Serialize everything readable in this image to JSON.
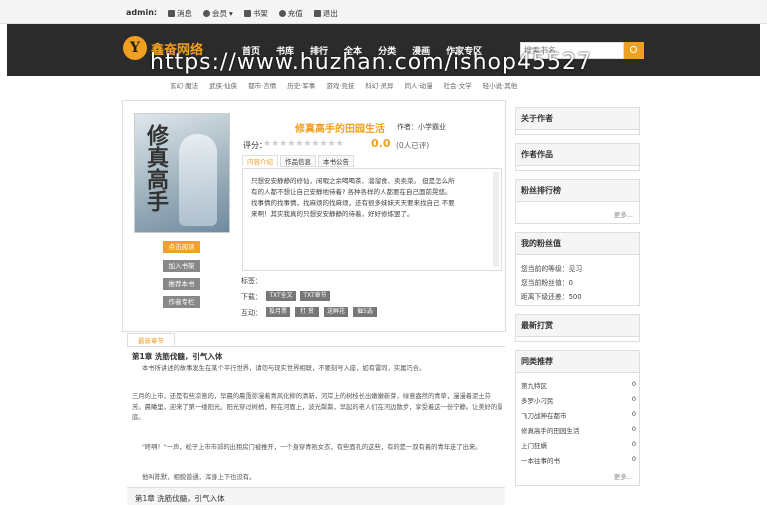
{
  "topbar": {
    "user": "admin:",
    "links": [
      {
        "icon": "message-icon",
        "label": "消息"
      },
      {
        "icon": "user-icon",
        "label": "会员"
      },
      {
        "icon": "book-icon",
        "label": "书架"
      },
      {
        "icon": "recharge-icon",
        "label": "充值"
      },
      {
        "icon": "logout-icon",
        "label": "退出"
      }
    ]
  },
  "header": {
    "logo_mark": "Y",
    "logo_text": "鑫奋网络",
    "nav": [
      "首页",
      "书库",
      "排行",
      "全本",
      "分类",
      "漫画",
      "作家专区"
    ],
    "search_placeholder": "搜索书名",
    "accent": "#f0a020"
  },
  "watermark": "https://www.huzhan.com/ishop45527",
  "categories": [
    "玄幻·魔法",
    "武侠·仙侠",
    "都市·言情",
    "历史·军事",
    "游戏·竞技",
    "科幻·灵异",
    "同人·动漫",
    "社会·文学",
    "轻小说·其他"
  ],
  "book": {
    "title": "修真高手的田园生活",
    "author_label": "作者：",
    "author": "小学霸业",
    "cover_title": "修真高手",
    "rating_label": "评分：",
    "stars": "★★★★★★★★★★",
    "score": "0.0",
    "score_count": "(0人已评)",
    "tabs": [
      "内容介绍",
      "作品信息",
      "本书公告"
    ],
    "intro": [
      "只想安安静静的修仙，闲暇之余喝喝茶、溜溜食、卖卖菜。 但是怎么所",
      "有的人都不想让自己安静地待着?  各种各样的人都要在自己面前晃悠。",
      "找事情的找事情，找麻烦的找麻烦，还有很多妹妹天天要来找自己   不要",
      "来啊！其实我真的只想安安静静的待着，好好修炼罢了。"
    ],
    "buttons": [
      "点击阅读",
      "加入书架",
      "推荐本书",
      "作者专栏"
    ],
    "tags_label": "标签：",
    "download_label": "下载：",
    "downloads": [
      "TXT全文",
      "TXT章节"
    ],
    "interact_label": "互动：",
    "interacts": [
      "投月票",
      "打 赏",
      "送鲜花",
      "催5选"
    ]
  },
  "latest": {
    "tab": "最新章节",
    "chapter_title": "第1章 洗筋伐髓，引气入体",
    "paras": [
      "本书所讲述的故事发生在某个平行世界，请勿与现实世界相联，不要刻号入座，如有雷同，实属巧合。",
      "三月的上市，还是有些凉意的，早晨的晨霭弥漫着青风化柳的清新，河岸上的树枝长出嫩嫩新芽，绿意盎然的青草，漫漫着泥土芬",
      "芳。晨曦里，迎来了第一缕阳光。阳光穿过树梢，照在河面上，波光粼粼，早起的老人们在河边散步，享受着这一份宁静。让美好的景色尽收眼",
      "底。",
      "\"咚啊！\"一声，松子上市市郊的出租房门被推开，一个身穿青袍女衣，有些面孔的这些，有的是一双有着的青年走了出来。",
      "他叫陈默，相貌普通，浑身上下也没有。"
    ],
    "bottom": "第1章 洗筋伐髓，引气入体"
  },
  "sidebar": {
    "about_author": "关于作者",
    "author_works": "作者作品",
    "fans_rank": "粉丝排行榜",
    "more": "更多...",
    "my_fans": "我的粉丝值",
    "fans_rows": [
      "您当前的等级：见习",
      "您当前粉丝值：0",
      "距离下级还差：500"
    ],
    "latest_tip": "最新打赏",
    "similar": "同类推荐",
    "similar_items": [
      {
        "name": "第九特区",
        "n": "0"
      },
      {
        "name": "多罗小刁民",
        "n": "0"
      },
      {
        "name": "飞刀战神在都市",
        "n": "0"
      },
      {
        "name": "修真高手的田园生活",
        "n": "0"
      },
      {
        "name": "上门狂婿",
        "n": "0"
      },
      {
        "name": "一本往事的书",
        "n": "0"
      }
    ]
  }
}
